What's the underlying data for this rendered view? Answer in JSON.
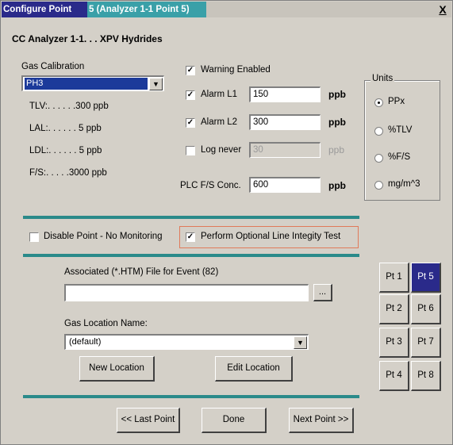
{
  "window": {
    "title_left": "Configure Point",
    "title_right": "5  (Analyzer 1-1  Point 5)",
    "close_label": "X"
  },
  "subtitle": "CC Analyzer 1-1. . .  XPV Hydrides",
  "gas_calibration": {
    "label": "Gas Calibration",
    "selected": "PH3"
  },
  "limits": {
    "tlv": "TLV:. . . . . .300  ppb",
    "lal": "LAL:. . . . . .  5  ppb",
    "ldl": "LDL:. . . . . .  5  ppb",
    "fs": "F/S:. . . . .3000  ppb"
  },
  "alarms": {
    "warning_enabled": {
      "label": "Warning Enabled",
      "checked": true
    },
    "alarm_l1": {
      "label": "Alarm L1",
      "value": "150",
      "unit": "ppb",
      "checked": true
    },
    "alarm_l2": {
      "label": "Alarm L2",
      "value": "300",
      "unit": "ppb",
      "checked": true
    },
    "log_never": {
      "label": "Log never",
      "value": "30",
      "unit": "ppb",
      "checked": false
    },
    "plc_fs": {
      "label": "PLC F/S Conc.",
      "value": "600",
      "unit": "ppb"
    }
  },
  "units": {
    "title": "Units",
    "options": [
      "PPx",
      "%TLV",
      "%F/S",
      "mg/m^3"
    ],
    "selected": "PPx"
  },
  "monitoring": {
    "disable_point": {
      "label": "Disable Point  - No Monitoring",
      "checked": false
    },
    "line_integrity": {
      "label": "Perform Optional Line Integity Test",
      "checked": true
    }
  },
  "event_file": {
    "label": "Associated (*.HTM) File for Event (82)",
    "value": "",
    "browse_label": "..."
  },
  "gas_location": {
    "label": "Gas Location Name:",
    "selected": "(default)"
  },
  "buttons": {
    "new_location": "New Location",
    "edit_location": "Edit Location",
    "last_point": "<< Last Point",
    "done": "Done",
    "next_point": "Next Point >>"
  },
  "points": [
    "Pt 1",
    "Pt 5",
    "Pt 2",
    "Pt 6",
    "Pt 3",
    "Pt 7",
    "Pt 4",
    "Pt 8"
  ],
  "active_point": "Pt 5",
  "glyphs": {
    "check": "✓",
    "arrow": "▼"
  }
}
